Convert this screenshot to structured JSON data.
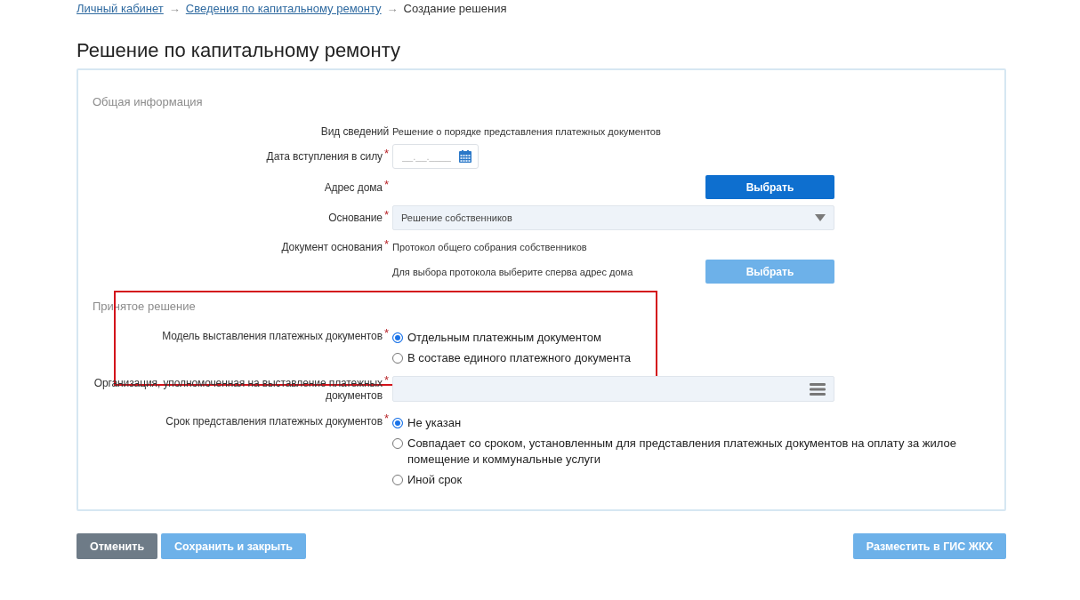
{
  "breadcrumbs": [
    {
      "kind": "link",
      "label": "Личный кабинет",
      "separator": "→"
    },
    {
      "kind": "link",
      "label": "Сведения по капитальному ремонту",
      "separator": "→"
    },
    {
      "kind": "current",
      "label": "Создание решения"
    }
  ],
  "page_title": "Решение по капитальному ремонту",
  "sections": [
    {
      "title": "Общая информация",
      "rows": [
        {
          "kind": "text",
          "label": "Вид сведений",
          "highlighted": false,
          "value": "Решение о порядке представления платежных документов"
        },
        {
          "kind": "date",
          "label": "Дата вступления в силу",
          "required_mark": "*",
          "highlighted": false,
          "placeholder": "__.__.____"
        },
        {
          "kind": "picker",
          "label": "Адрес дома",
          "required_mark": "*",
          "highlighted": false,
          "button": {
            "label": "Выбрать",
            "disabled": false
          }
        },
        {
          "kind": "select",
          "label": "Основание",
          "required_mark": "*",
          "highlighted": false,
          "value": "Решение собственников"
        },
        {
          "kind": "document",
          "label": "Документ основания",
          "required_mark": "*",
          "highlighted": false,
          "value": "Протокол общего собрания собственников",
          "hint": "Для выбора протокола выберите сперва адрес дома",
          "button": {
            "label": "Выбрать",
            "disabled": true
          }
        }
      ]
    },
    {
      "title": "Принятое решение",
      "rows": [
        {
          "kind": "radio",
          "label": "Модель выставления платежных документов",
          "required_mark": "*",
          "highlighted": true,
          "options": [
            {
              "label": "Отдельным платежным документом",
              "selected": true
            },
            {
              "label": "В составе единого платежного документа",
              "selected": false
            }
          ]
        },
        {
          "kind": "lookup",
          "label": "Организация, уполномоченная на выставление платежных документов",
          "required_mark": "*",
          "highlighted": false
        },
        {
          "kind": "radio",
          "label": "Срок представления платежных документов",
          "required_mark": "*",
          "highlighted": false,
          "options": [
            {
              "label": "Не указан",
              "selected": true
            },
            {
              "label": "Совпадает со сроком, установленным для представления платежных документов на оплату за жилое помещение и коммунальные услуги",
              "selected": false
            },
            {
              "label": "Иной срок",
              "selected": false
            }
          ]
        }
      ]
    }
  ],
  "actions": {
    "left": [
      {
        "kind": "neutral",
        "label": "Отменить",
        "disabled": false
      },
      {
        "kind": "primary",
        "label": "Сохранить и закрыть",
        "disabled": true
      }
    ],
    "right": [
      {
        "kind": "primary",
        "label": "Разместить в ГИС ЖКХ",
        "disabled": true
      }
    ]
  }
}
